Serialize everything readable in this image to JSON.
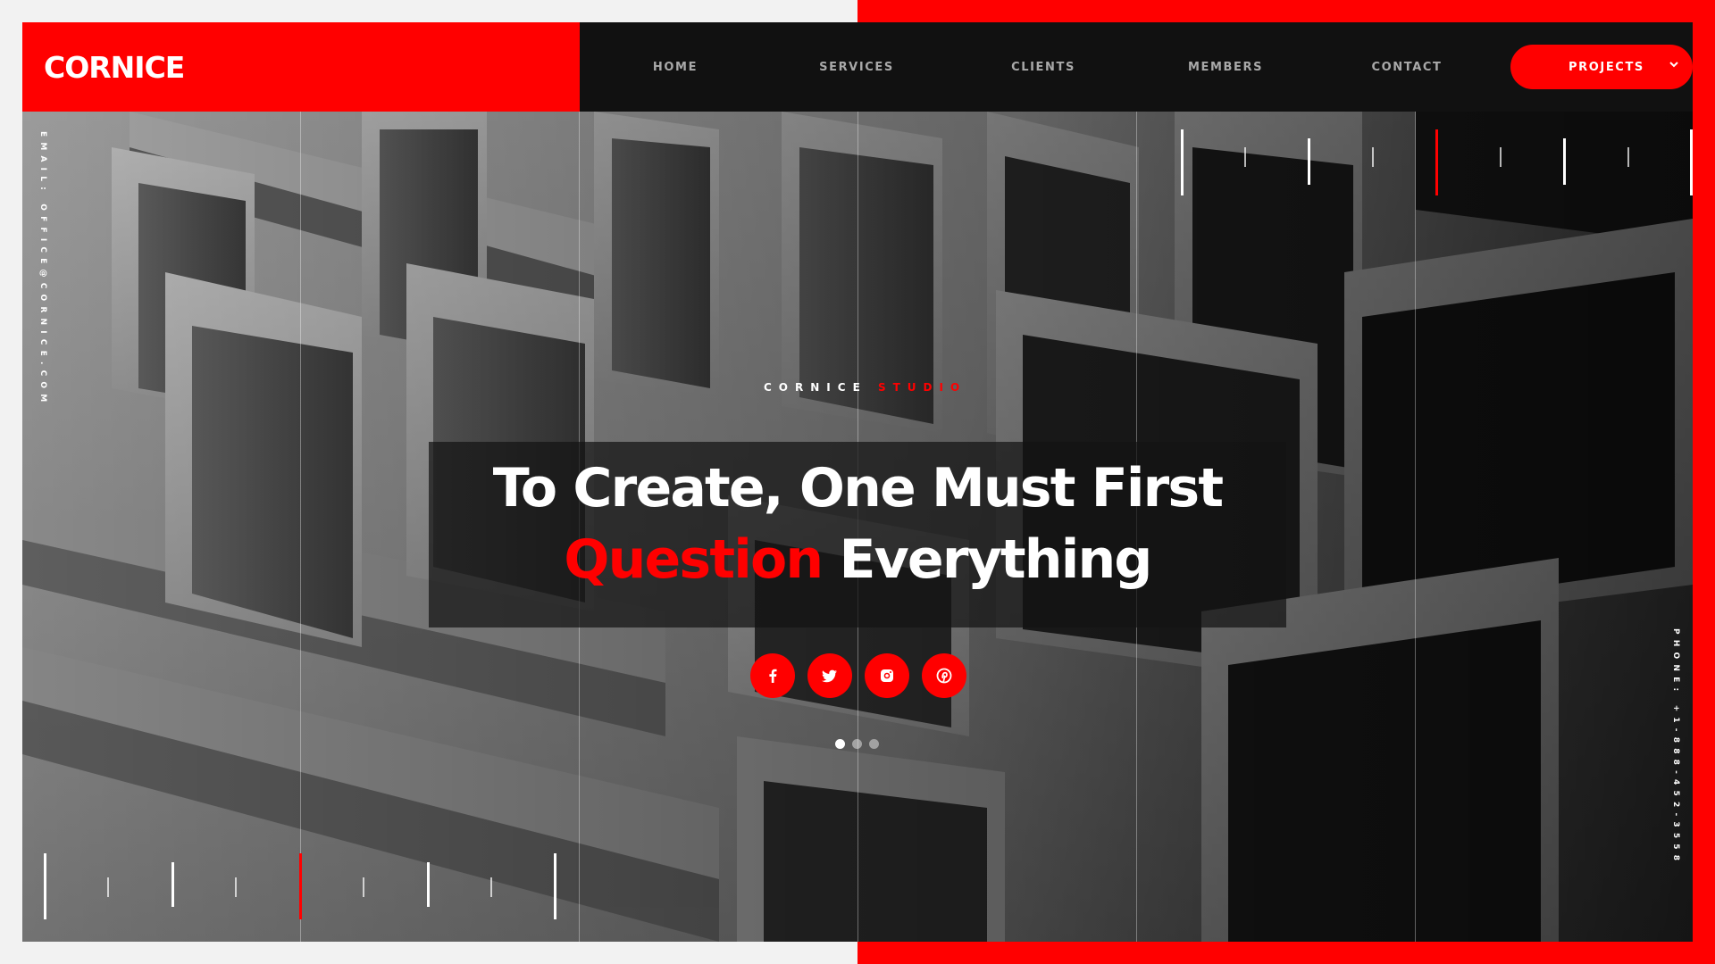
{
  "brand": {
    "logo": "CORNICE"
  },
  "nav": {
    "items": [
      "HOME",
      "SERVICES",
      "CLIENTS",
      "MEMBERS",
      "CONTACT"
    ],
    "projects_label": "PROJECTS"
  },
  "hero": {
    "kicker_white": "CORNICE",
    "kicker_red": "STUDIO",
    "title_line1": "To Create, One Must First",
    "title_red": "Question",
    "title_rest": "Everything",
    "email_text": "EMAIL: OFFICE@CORNICE.COM",
    "phone_text": "PHONE: +1-888-452-3558"
  },
  "socials": [
    "facebook-icon",
    "twitter-icon",
    "instagram-icon",
    "pinterest-icon"
  ],
  "slider": {
    "total": 3,
    "active": 1
  },
  "colors": {
    "accent": "#ff0000",
    "dark": "#111111",
    "nav_text": "#a9a9a9"
  }
}
